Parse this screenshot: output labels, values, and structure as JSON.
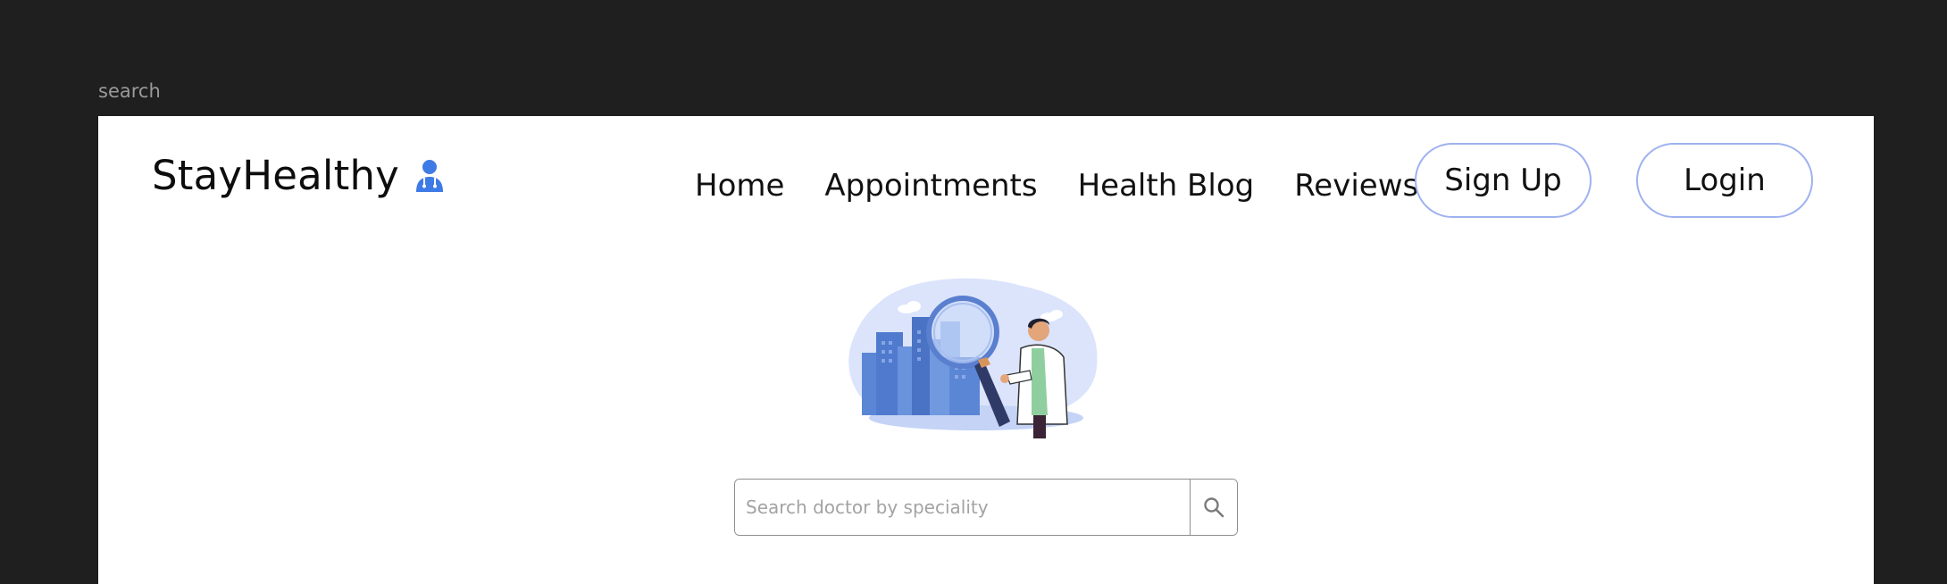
{
  "frame": {
    "label": "search"
  },
  "brand": {
    "name": "StayHealthy",
    "icon": "doctor-icon"
  },
  "nav": {
    "links": [
      "Home",
      "Appointments",
      "Health Blog",
      "Reviews"
    ],
    "signup_label": "Sign Up",
    "login_label": "Login"
  },
  "hero": {
    "illustration": "doctor-magnifying-city-illustration"
  },
  "search": {
    "value": "",
    "placeholder": "Search doctor by speciality",
    "icon": "search-icon"
  },
  "colors": {
    "page_bg": "#1f1f1f",
    "frame_bg": "#ffffff",
    "pill_border": "#9fb2f0",
    "brand_icon": "#3f7be6",
    "illustration_blue": "#5b86d6"
  }
}
